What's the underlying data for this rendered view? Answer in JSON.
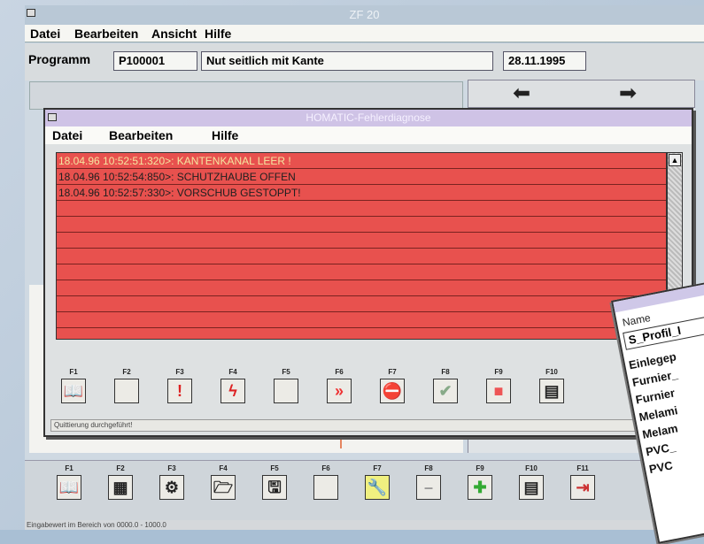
{
  "window": {
    "title": "ZF 20"
  },
  "menu": [
    {
      "label": "Datei"
    },
    {
      "label": "Bearbeiten"
    },
    {
      "label": "Ansicht"
    },
    {
      "label": "Hilfe"
    }
  ],
  "program": {
    "label": "Programm",
    "code": "P100001",
    "description": "Nut seitlich mit Kante",
    "date": "28.11.1995"
  },
  "nav": {
    "back_icon": "arrow-left-icon",
    "forward_icon": "arrow-right-icon"
  },
  "dialog": {
    "title": "HOMATIC-Fehlerdiagnose",
    "menu": [
      {
        "label": "Datei"
      },
      {
        "label": "Bearbeiten"
      },
      {
        "label": "Hilfe"
      }
    ],
    "messages": [
      "18.04.96 10:52:51:320>: KANTENKANAL LEER !",
      "18.04.96 10:52:54:850>: SCHUTZHAUBE OFFEN",
      "18.04.96 10:52:57:330>: VORSCHUB GESTOPPT!"
    ],
    "fkeys": [
      {
        "label": "F1",
        "icon": "book-icon"
      },
      {
        "label": "F2",
        "icon": "blank-icon"
      },
      {
        "label": "F3",
        "icon": "exclamation-icon"
      },
      {
        "label": "F4",
        "icon": "lightning-icon"
      },
      {
        "label": "F5",
        "icon": "blank-icon"
      },
      {
        "label": "F6",
        "icon": "double-chevron-icon"
      },
      {
        "label": "F7",
        "icon": "error-stop-icon"
      },
      {
        "label": "F8",
        "icon": "check-icon"
      },
      {
        "label": "F9",
        "icon": "red-box-icon"
      },
      {
        "label": "F10",
        "icon": "calculator-icon"
      }
    ],
    "status": "Quittierung durchgeführt!"
  },
  "main_fkeys": [
    {
      "label": "F1",
      "icon": "book-icon"
    },
    {
      "label": "F2",
      "icon": "machine-icon"
    },
    {
      "label": "F3",
      "icon": "tools-icon"
    },
    {
      "label": "F4",
      "icon": "folder-open-icon"
    },
    {
      "label": "F5",
      "icon": "save-icon"
    },
    {
      "label": "F6",
      "icon": "blank-icon"
    },
    {
      "label": "F7",
      "icon": "wrench-icon"
    },
    {
      "label": "F8",
      "icon": "minus-icon"
    },
    {
      "label": "F9",
      "icon": "plus-icon"
    },
    {
      "label": "F10",
      "icon": "calculator-icon"
    },
    {
      "label": "F11",
      "icon": "exit-icon"
    }
  ],
  "status_bar": "Eingabewert im Bereich von 0000.0 - 1000.0",
  "popup": {
    "header": "Name",
    "profile": "S_Profil_I",
    "items": [
      "Einlegep",
      "Furnier_",
      "Furnier",
      "Melami",
      "Melam",
      "PVC_",
      "PVC"
    ]
  }
}
